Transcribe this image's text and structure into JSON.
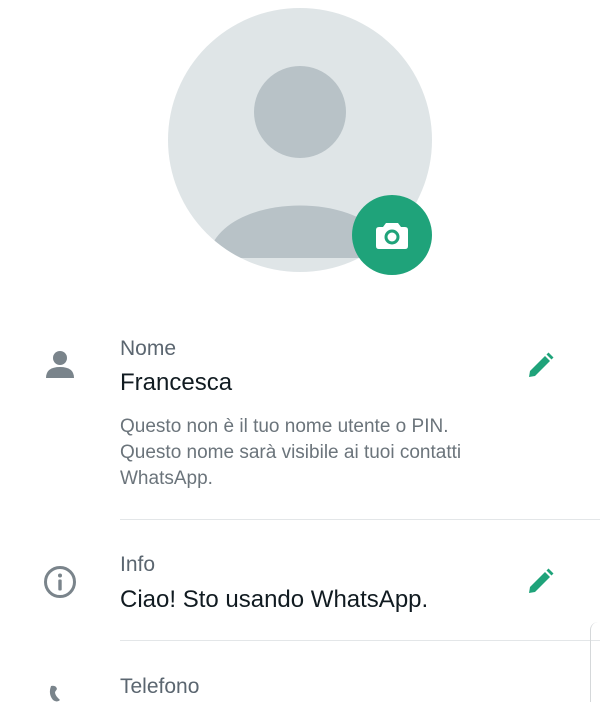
{
  "profile": {
    "photo_alt": "Foto profilo",
    "camera_icon": "camera-icon"
  },
  "name_row": {
    "icon": "person-icon",
    "label": "Nome",
    "value": "Francesca",
    "edit_icon": "pencil-icon",
    "helper_lines": [
      "Questo non è il tuo nome utente o PIN.",
      "Questo nome sarà visibile ai tuoi contatti",
      "WhatsApp."
    ]
  },
  "info_row": {
    "icon": "info-icon",
    "label": "Info",
    "value": "Ciao! Sto usando WhatsApp.",
    "edit_icon": "pencil-icon"
  },
  "phone_row": {
    "icon": "phone-icon",
    "label": "Telefono"
  },
  "colors": {
    "accent": "#1fa37a",
    "icon_gray": "#7a848b",
    "text_primary": "#111b21",
    "text_secondary": "#5b6670"
  }
}
